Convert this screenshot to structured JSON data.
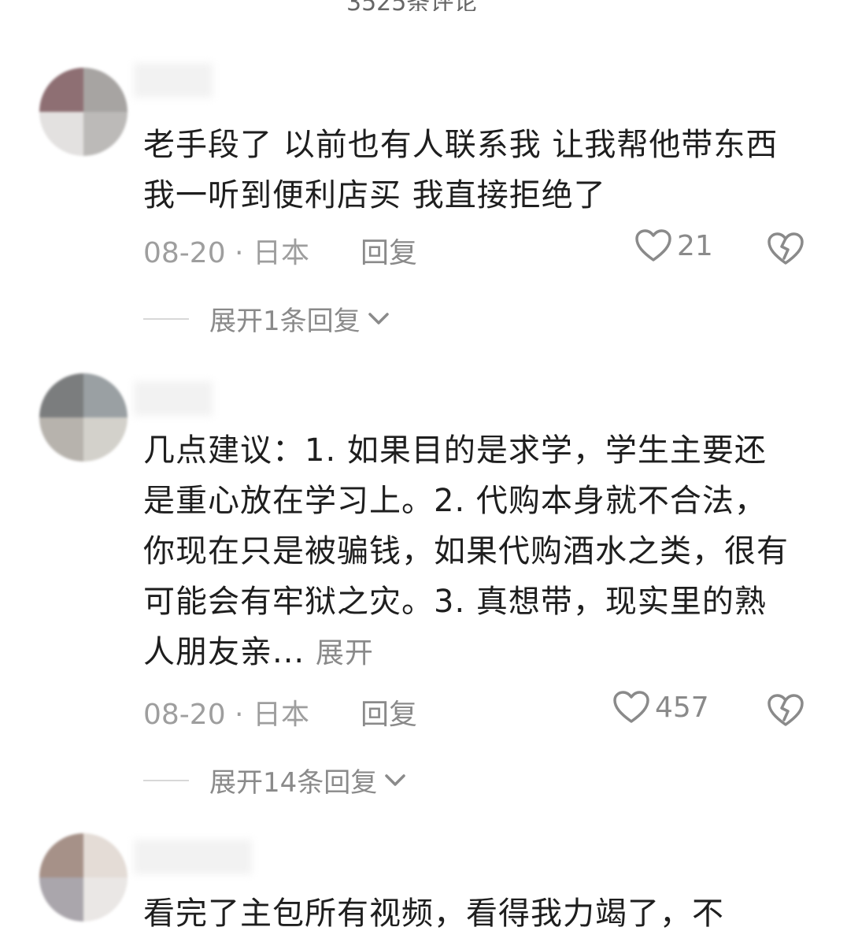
{
  "comments": [
    {
      "text": "老手段了  以前也有人联系我 让我帮他带东西 我一听到便利店买 我直接拒绝了",
      "expand_text": "",
      "date_location": "08-20 · 日本",
      "reply_label": "回复",
      "likes": "21",
      "expand_replies": "展开1条回复",
      "avatar_colors": [
        "#8e6f73",
        "#a7a4a2",
        "#e3e1e0",
        "#bcbab8"
      ]
    },
    {
      "text": "几点建议：1. 如果目的是求学，学生主要还是重心放在学习上。2. 代购本身就不合法，你现在只是被骗钱，如果代购酒水之类，很有可能会有牢狱之灾。3. 真想带，现实里的熟人朋友亲...",
      "expand_text": "展开",
      "date_location": "08-20 · 日本",
      "reply_label": "回复",
      "likes": "457",
      "expand_replies": "展开14条回复",
      "avatar_colors": [
        "#7b7d7e",
        "#9aa0a3",
        "#b7b3ad",
        "#d3d1cb"
      ]
    },
    {
      "text": "看完了主包所有视频，看得我力竭了，不",
      "expand_text": "",
      "date_location": "",
      "reply_label": "",
      "likes": "",
      "expand_replies": "",
      "avatar_colors": [
        "#a69188",
        "#e4dcd6",
        "#aaa6ac",
        "#eae7e5"
      ]
    }
  ],
  "icons": {
    "like": "heart-outline-icon",
    "dislike": "broken-heart-icon",
    "expand": "chevron-down-icon"
  }
}
